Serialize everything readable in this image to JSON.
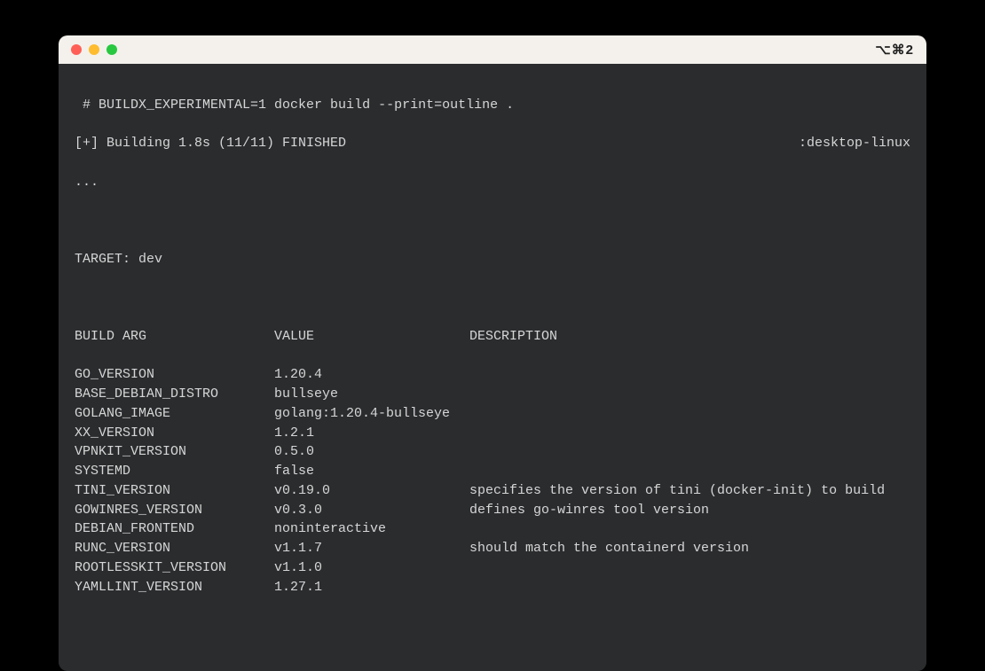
{
  "titlebar": {
    "shortcut": "⌥⌘2"
  },
  "terminal": {
    "prompt_prefix": " # ",
    "command": "BUILDX_EXPERIMENTAL=1 docker build --print=outline .",
    "status_left": "[+] Building 1.8s (11/11) FINISHED",
    "status_right": ":desktop-linux",
    "ellipsis": "...",
    "target_line": "TARGET: dev",
    "headers": {
      "arg": "BUILD ARG",
      "val": "VALUE",
      "desc": "DESCRIPTION"
    },
    "rows": [
      {
        "arg": "GO_VERSION",
        "val": "1.20.4",
        "desc": ""
      },
      {
        "arg": "BASE_DEBIAN_DISTRO",
        "val": "bullseye",
        "desc": ""
      },
      {
        "arg": "GOLANG_IMAGE",
        "val": "golang:1.20.4-bullseye",
        "desc": ""
      },
      {
        "arg": "XX_VERSION",
        "val": "1.2.1",
        "desc": ""
      },
      {
        "arg": "VPNKIT_VERSION",
        "val": "0.5.0",
        "desc": ""
      },
      {
        "arg": "SYSTEMD",
        "val": "false",
        "desc": ""
      },
      {
        "arg": "TINI_VERSION",
        "val": "v0.19.0",
        "desc": "specifies the version of tini (docker-init) to build"
      },
      {
        "arg": "GOWINRES_VERSION",
        "val": "v0.3.0",
        "desc": "defines go-winres tool version"
      },
      {
        "arg": "DEBIAN_FRONTEND",
        "val": "noninteractive",
        "desc": ""
      },
      {
        "arg": "RUNC_VERSION",
        "val": "v1.1.7",
        "desc": "should match the containerd version"
      },
      {
        "arg": "ROOTLESSKIT_VERSION",
        "val": "v1.1.0",
        "desc": ""
      },
      {
        "arg": "YAMLLINT_VERSION",
        "val": "1.27.1",
        "desc": ""
      }
    ]
  }
}
